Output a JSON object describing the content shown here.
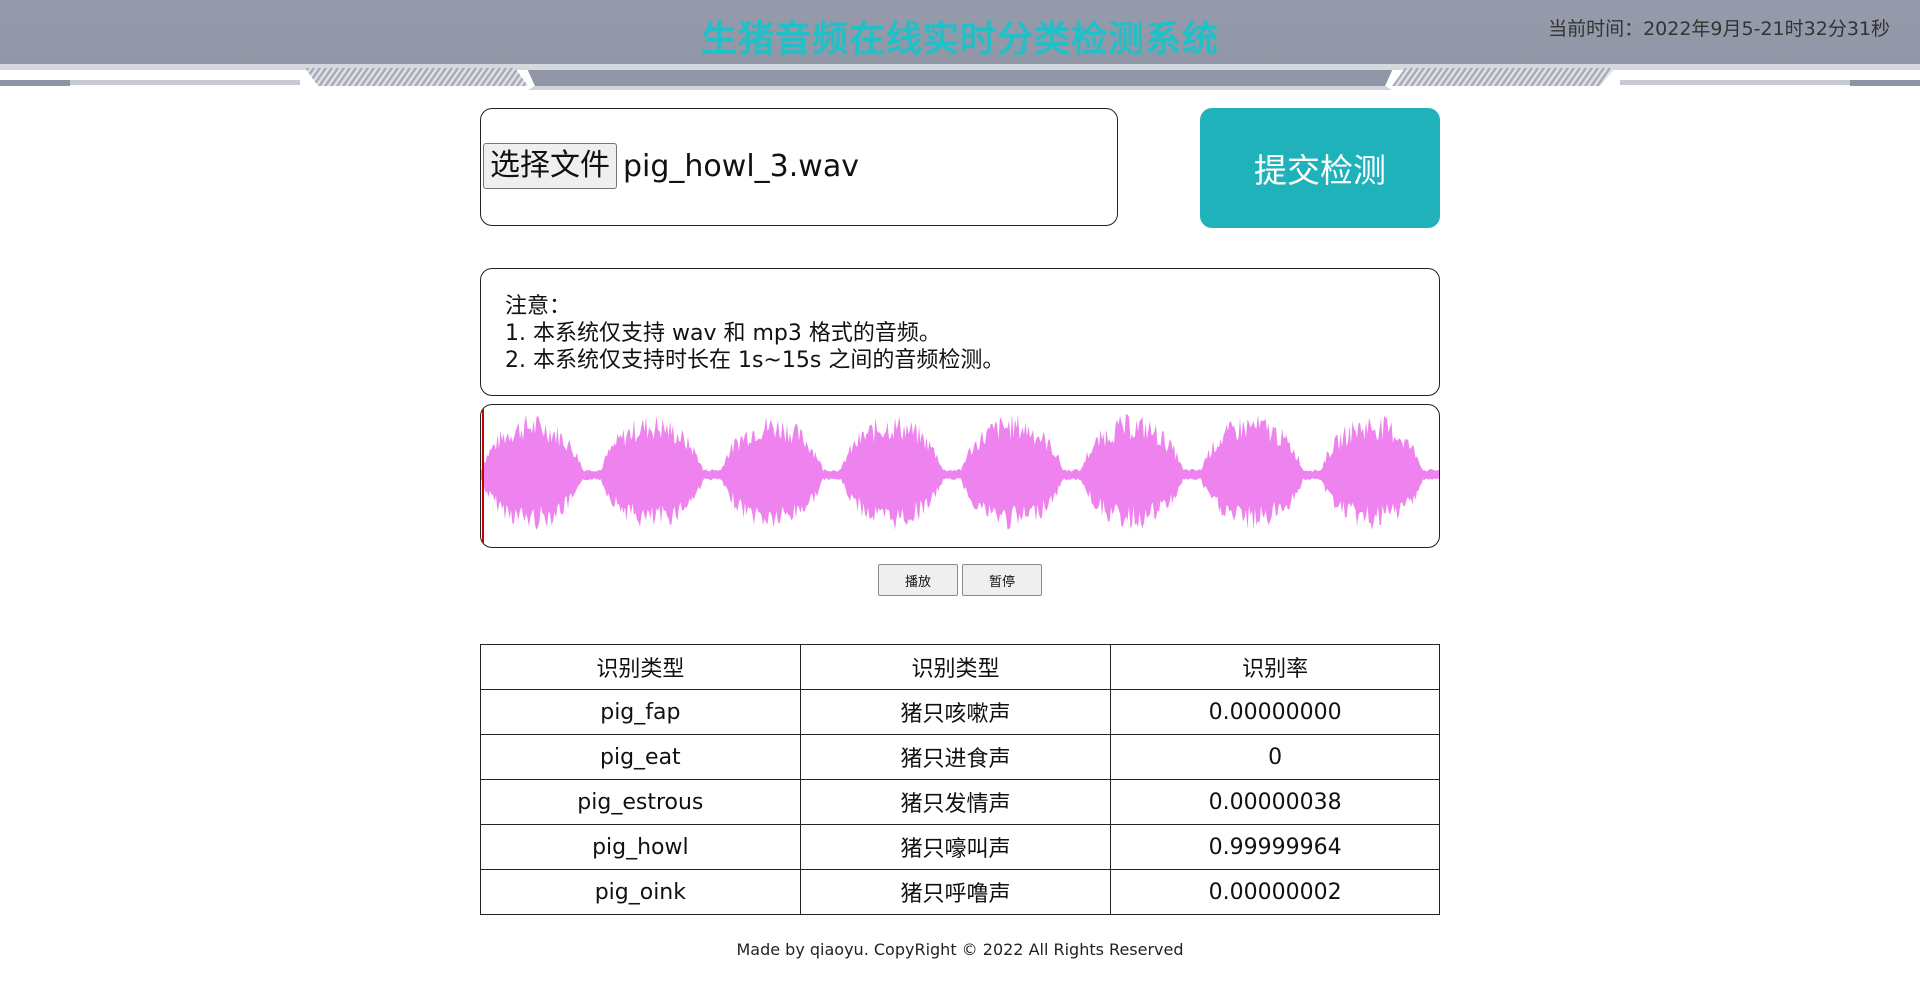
{
  "header": {
    "title": "生猪音频在线实时分类检测系统",
    "time_label": "当前时间：",
    "time_value": "2022年9月5-21时32分31秒"
  },
  "upload": {
    "choose_button_label": "选择文件",
    "file_name": "pig_howl_3.wav",
    "submit_label": "提交检测"
  },
  "notice": {
    "lines": [
      "注意：",
      "1. 本系统仅支持 wav 和 mp3 格式的音频。",
      "2. 本系统仅支持时长在 1s~15s 之间的音频检测。"
    ]
  },
  "player": {
    "waveform_color": "#ee82ee",
    "cursor_color": "#cc0000",
    "play_label": "播放",
    "pause_label": "暂停"
  },
  "results": {
    "headers": [
      "识别类型",
      "识别类型",
      "识别率"
    ],
    "rows": [
      [
        "pig_fap",
        "猪只咳嗽声",
        "0.00000000"
      ],
      [
        "pig_eat",
        "猪只进食声",
        "0"
      ],
      [
        "pig_estrous",
        "猪只发情声",
        "0.00000038"
      ],
      [
        "pig_howl",
        "猪只嚎叫声",
        "0.99999964"
      ],
      [
        "pig_oink",
        "猪只呼噜声",
        "0.00000002"
      ]
    ]
  },
  "footer": {
    "text": "Made by qiaoyu. CopyRight © 2022 All Rights Reserved"
  },
  "theme": {
    "header_bg": "#9aa0ad",
    "title_color": "#20c0c8",
    "accent": "#20b2ba"
  }
}
